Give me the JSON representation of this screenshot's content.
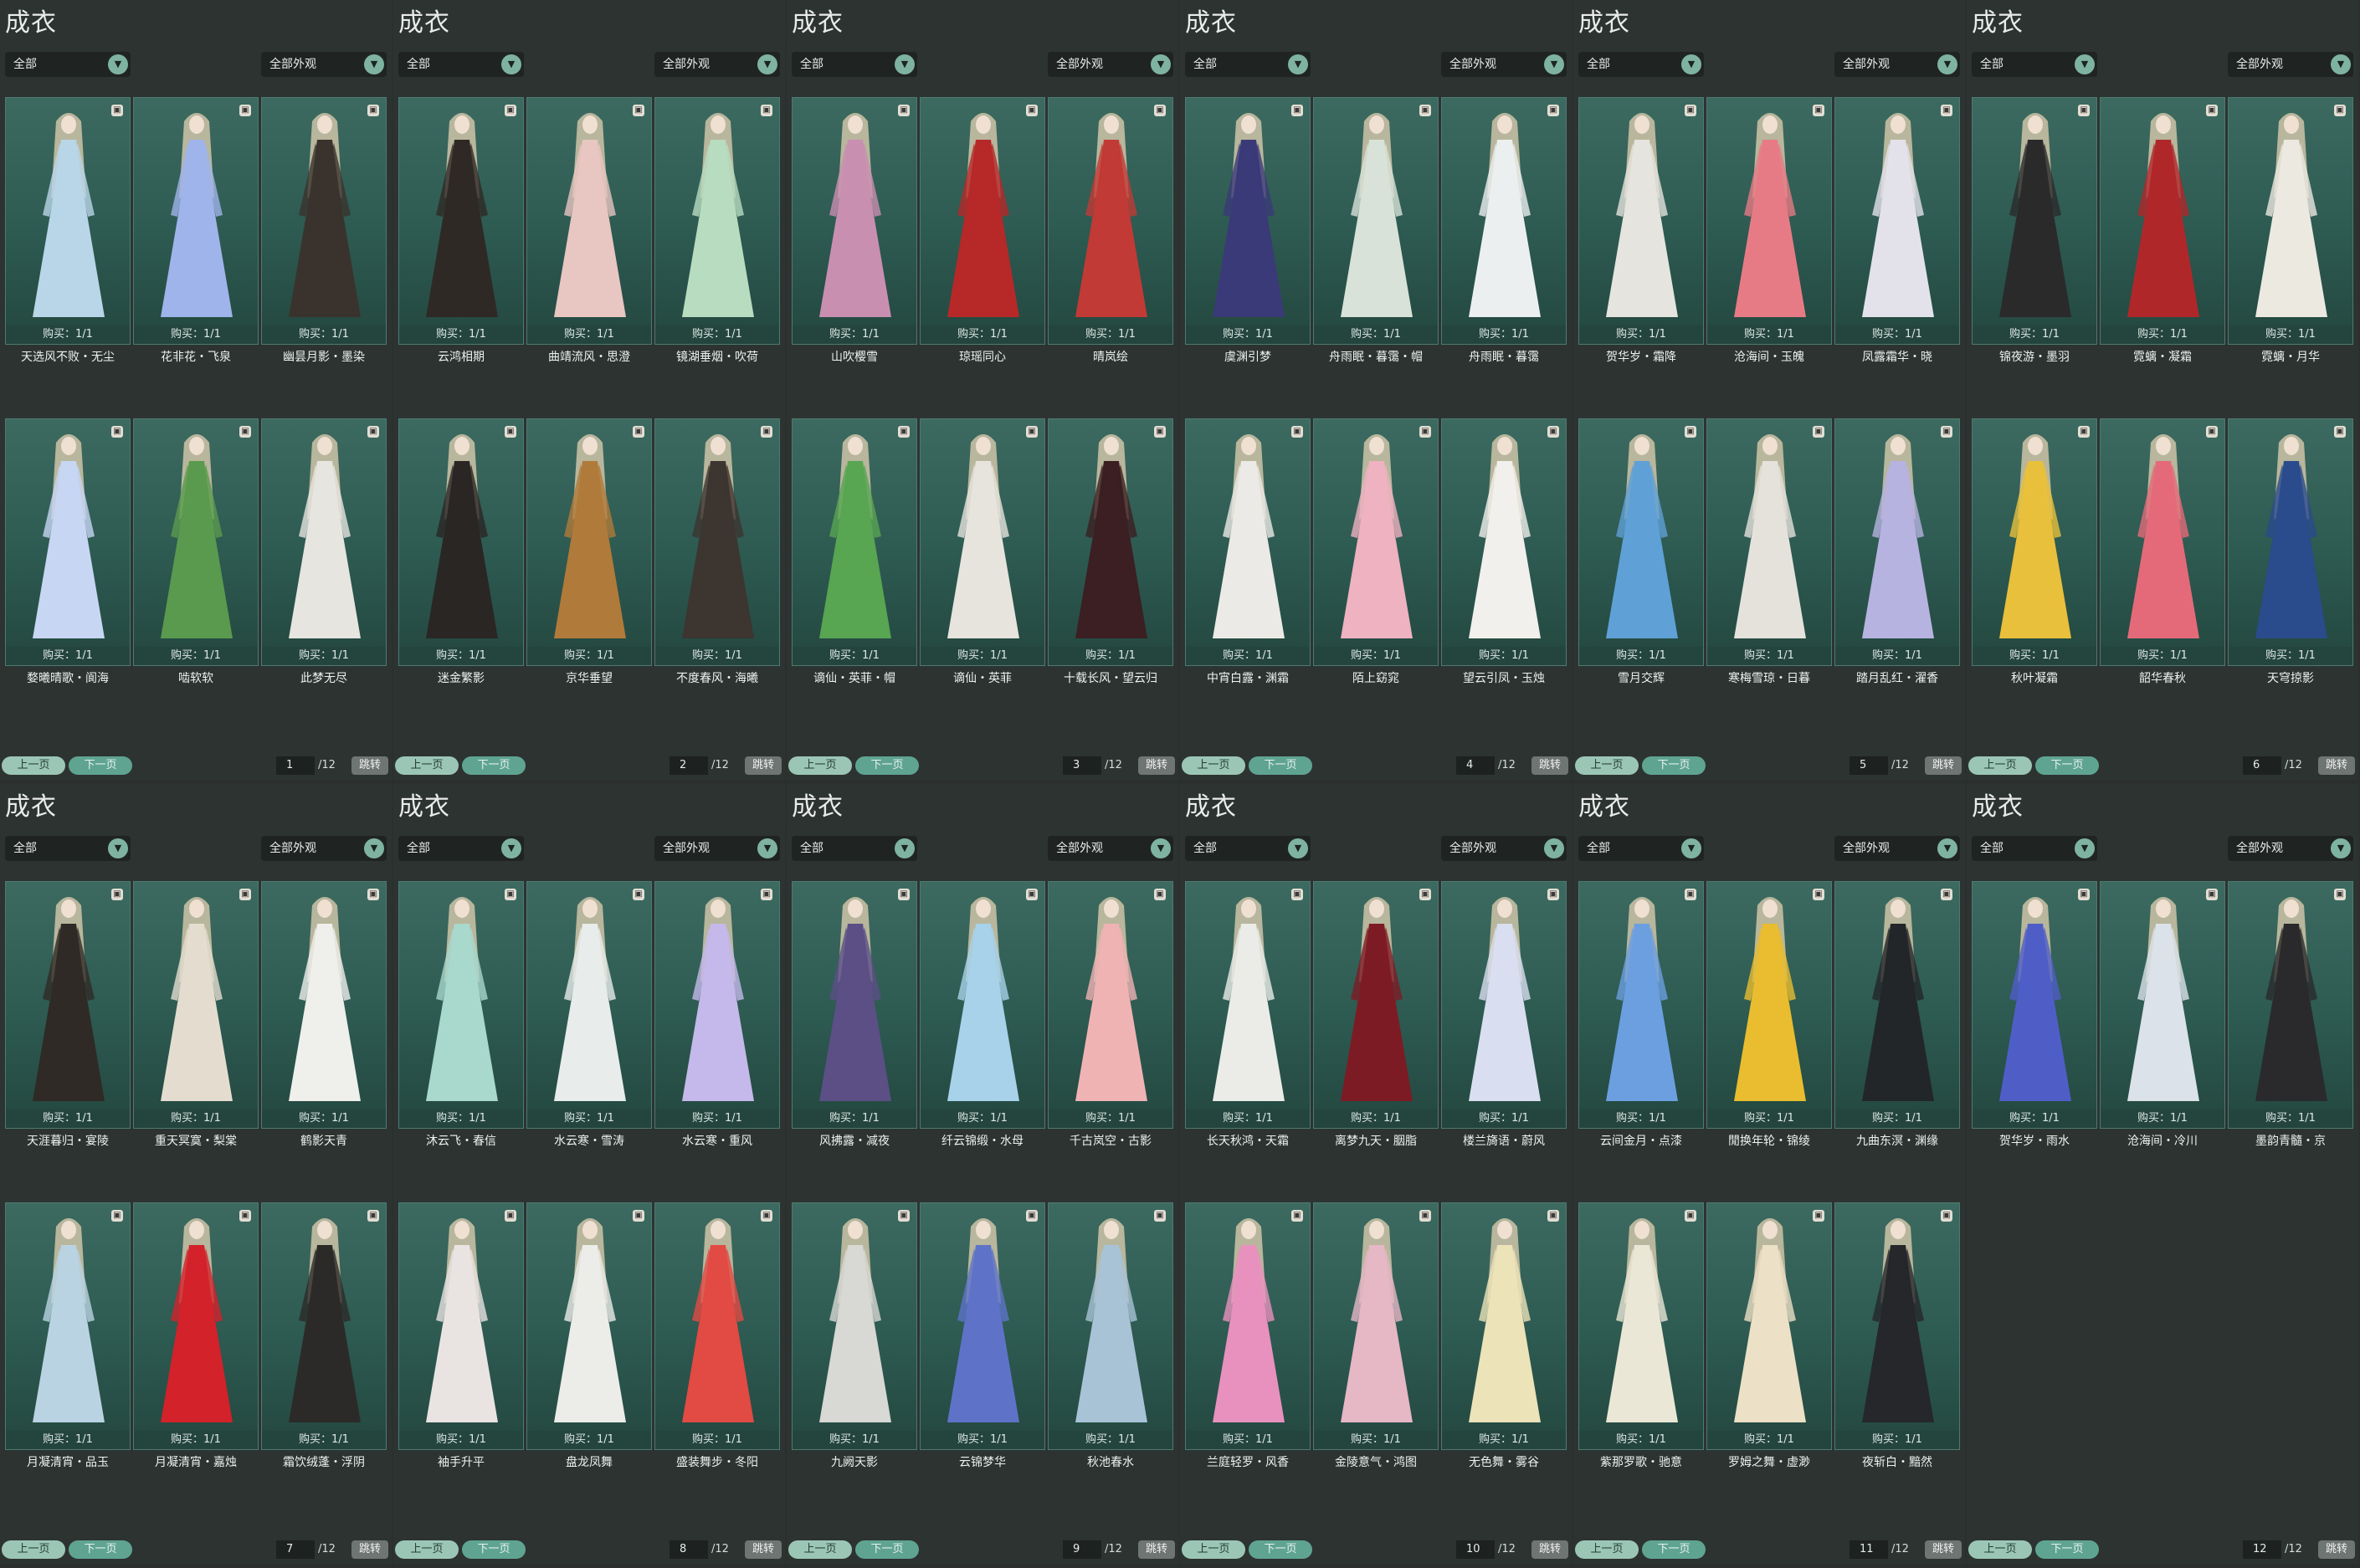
{
  "panels": [
    {
      "title": "成衣",
      "filter_left": "全部",
      "filter_right": "全部外观",
      "page": "1",
      "total": "/12",
      "prev": "上一页",
      "next": "下一页",
      "jump": "跳转",
      "items": [
        {
          "name": "天选风不败・无尘",
          "buy": "购买：1/1",
          "c": "#b9d6e8"
        },
        {
          "name": "花非花・飞泉",
          "buy": "购买：1/1",
          "c": "#9fb4ea"
        },
        {
          "name": "幽昙月影・墨染",
          "buy": "购买：1/1",
          "c": "#3a332d"
        },
        {
          "name": "婺曦晴歌・阆海",
          "buy": "购买：1/1",
          "c": "#c7d6f2"
        },
        {
          "name": "啮软软",
          "buy": "购买：1/1",
          "c": "#5a9a4e"
        },
        {
          "name": "此梦无尽",
          "buy": "购买：1/1",
          "c": "#e7e5e0"
        }
      ]
    },
    {
      "title": "成衣",
      "filter_left": "全部",
      "filter_right": "全部外观",
      "page": "2",
      "total": "/12",
      "prev": "上一页",
      "next": "下一页",
      "jump": "跳转",
      "items": [
        {
          "name": "云鸿相期",
          "buy": "购买：1/1",
          "c": "#2f2926"
        },
        {
          "name": "曲靖流风・思澄",
          "buy": "购买：1/1",
          "c": "#e8c6c1"
        },
        {
          "name": "镜湖垂烟・吹荷",
          "buy": "购买：1/1",
          "c": "#b8dcbf"
        },
        {
          "name": "迷金繁影",
          "buy": "购买：1/1",
          "c": "#2a2624"
        },
        {
          "name": "京华垂望",
          "buy": "购买：1/1",
          "c": "#b07a3a"
        },
        {
          "name": "不度春风・海曦",
          "buy": "购买：1/1",
          "c": "#3d3530"
        }
      ]
    },
    {
      "title": "成衣",
      "filter_left": "全部",
      "filter_right": "全部外观",
      "page": "3",
      "total": "/12",
      "prev": "上一页",
      "next": "下一页",
      "jump": "跳转",
      "items": [
        {
          "name": "山吹樱雪",
          "buy": "购买：1/1",
          "c": "#c98fb0"
        },
        {
          "name": "琼瑶同心",
          "buy": "购买：1/1",
          "c": "#b72828"
        },
        {
          "name": "晴岚绘",
          "buy": "购买：1/1",
          "c": "#c23a35"
        },
        {
          "name": "谪仙・英菲・帽",
          "buy": "购买：1/1",
          "c": "#58a552"
        },
        {
          "name": "谪仙・英菲",
          "buy": "购买：1/1",
          "c": "#e7e4dd"
        },
        {
          "name": "十载长风・望云归",
          "buy": "购买：1/1",
          "c": "#3b1f22"
        }
      ]
    },
    {
      "title": "成衣",
      "filter_left": "全部",
      "filter_right": "全部外观",
      "page": "4",
      "total": "/12",
      "prev": "上一页",
      "next": "下一页",
      "jump": "跳转",
      "items": [
        {
          "name": "虞渊引梦",
          "buy": "购买：1/1",
          "c": "#3b3a78"
        },
        {
          "name": "舟雨眠・暮霭・帽",
          "buy": "购买：1/1",
          "c": "#d8e2d8"
        },
        {
          "name": "舟雨眠・暮霭",
          "buy": "购买：1/1",
          "c": "#eceff0"
        },
        {
          "name": "中宵白露・渊霜",
          "buy": "购买：1/1",
          "c": "#eceae6"
        },
        {
          "name": "陌上窈窕",
          "buy": "购买：1/1",
          "c": "#efb2c0"
        },
        {
          "name": "望云引凤・玉烛",
          "buy": "购买：1/1",
          "c": "#f2f0ec"
        }
      ]
    },
    {
      "title": "成衣",
      "filter_left": "全部",
      "filter_right": "全部外观",
      "page": "5",
      "total": "/12",
      "prev": "上一页",
      "next": "下一页",
      "jump": "跳转",
      "items": [
        {
          "name": "贺华岁・霜降",
          "buy": "购买：1/1",
          "c": "#e6e4df"
        },
        {
          "name": "沧海间・玉魄",
          "buy": "购买：1/1",
          "c": "#e77b85"
        },
        {
          "name": "凤露霜华・晓",
          "buy": "购买：1/1",
          "c": "#e3e2ea"
        },
        {
          "name": "雪月交辉",
          "buy": "购买：1/1",
          "c": "#5fa0d6"
        },
        {
          "name": "寒梅雪琼・日暮",
          "buy": "购买：1/1",
          "c": "#e5e2dc"
        },
        {
          "name": "踏月乱红・濯香",
          "buy": "购买：1/1",
          "c": "#b7b3e0"
        }
      ]
    },
    {
      "title": "成衣",
      "filter_left": "全部",
      "filter_right": "全部外观",
      "page": "6",
      "total": "/12",
      "prev": "上一页",
      "next": "下一页",
      "jump": "跳转",
      "items": [
        {
          "name": "锦夜游・墨羽",
          "buy": "购买：1/1",
          "c": "#2b2a2b"
        },
        {
          "name": "霓螭・凝霜",
          "buy": "购买：1/1",
          "c": "#b0272a"
        },
        {
          "name": "霓螭・月华",
          "buy": "购买：1/1",
          "c": "#ece9e1"
        },
        {
          "name": "秋叶凝霜",
          "buy": "购买：1/1",
          "c": "#e9c03b"
        },
        {
          "name": "韶华春秋",
          "buy": "购买：1/1",
          "c": "#e56a79"
        },
        {
          "name": "天穹掠影",
          "buy": "购买：1/1",
          "c": "#2a4b8c"
        }
      ]
    },
    {
      "title": "成衣",
      "filter_left": "全部",
      "filter_right": "全部外观",
      "page": "7",
      "total": "/12",
      "prev": "上一页",
      "next": "下一页",
      "jump": "跳转",
      "items": [
        {
          "name": "天涯暮归・宴陵",
          "buy": "购买：1/1",
          "c": "#2f2a26"
        },
        {
          "name": "重天冥寞・梨棠",
          "buy": "购买：1/1",
          "c": "#e4ddcf"
        },
        {
          "name": "鹤影天青",
          "buy": "购买：1/1",
          "c": "#efefec"
        },
        {
          "name": "月凝清宵・品玉",
          "buy": "购买：1/1",
          "c": "#b9d3e2"
        },
        {
          "name": "月凝清宵・嘉烛",
          "buy": "购买：1/1",
          "c": "#d3222a"
        },
        {
          "name": "霜饮绒蓬・浮阴",
          "buy": "购买：1/1",
          "c": "#2c2a28"
        }
      ]
    },
    {
      "title": "成衣",
      "filter_left": "全部",
      "filter_right": "全部外观",
      "page": "8",
      "total": "/12",
      "prev": "上一页",
      "next": "下一页",
      "jump": "跳转",
      "items": [
        {
          "name": "沐云飞・春信",
          "buy": "购买：1/1",
          "c": "#a9d8cc"
        },
        {
          "name": "水云寒・雪涛",
          "buy": "购买：1/1",
          "c": "#e8ecea"
        },
        {
          "name": "水云寒・重风",
          "buy": "购买：1/1",
          "c": "#c4b9ea"
        },
        {
          "name": "袖手升平",
          "buy": "购买：1/1",
          "c": "#e9e4e2"
        },
        {
          "name": "盘龙凤舞",
          "buy": "购买：1/1",
          "c": "#ecece8"
        },
        {
          "name": "盛装舞步・冬阳",
          "buy": "购买：1/1",
          "c": "#e24a44"
        }
      ]
    },
    {
      "title": "成衣",
      "filter_left": "全部",
      "filter_right": "全部外观",
      "page": "9",
      "total": "/12",
      "prev": "上一页",
      "next": "下一页",
      "jump": "跳转",
      "items": [
        {
          "name": "风拂露・减夜",
          "buy": "购买：1/1",
          "c": "#5b4f86"
        },
        {
          "name": "纤云锦缎・水母",
          "buy": "购买：1/1",
          "c": "#a8d2ea"
        },
        {
          "name": "千古岚空・古影",
          "buy": "购买：1/1",
          "c": "#f0b3b4"
        },
        {
          "name": "九阙天影",
          "buy": "购买：1/1",
          "c": "#d8d8d4"
        },
        {
          "name": "云锦梦华",
          "buy": "购买：1/1",
          "c": "#5e73c8"
        },
        {
          "name": "秋池春水",
          "buy": "购买：1/1",
          "c": "#a9c3d6"
        }
      ]
    },
    {
      "title": "成衣",
      "filter_left": "全部",
      "filter_right": "全部外观",
      "page": "10",
      "total": "/12",
      "prev": "上一页",
      "next": "下一页",
      "jump": "跳转",
      "items": [
        {
          "name": "长天秋鸿・天霜",
          "buy": "购买：1/1",
          "c": "#ebece8"
        },
        {
          "name": "离梦九天・胭脂",
          "buy": "购买：1/1",
          "c": "#7d1b24"
        },
        {
          "name": "楼兰旖语・蔚风",
          "buy": "购买：1/1",
          "c": "#d9dff0"
        },
        {
          "name": "兰庭轻罗・风香",
          "buy": "购买：1/1",
          "c": "#e891be"
        },
        {
          "name": "金陵意气・鸿图",
          "buy": "购买：1/1",
          "c": "#e6b7c5"
        },
        {
          "name": "无色舞・雾谷",
          "buy": "购买：1/1",
          "c": "#ece3b9"
        }
      ]
    },
    {
      "title": "成衣",
      "filter_left": "全部",
      "filter_right": "全部外观",
      "page": "11",
      "total": "/12",
      "prev": "上一页",
      "next": "下一页",
      "jump": "跳转",
      "items": [
        {
          "name": "云间金月・点漆",
          "buy": "购买：1/1",
          "c": "#6c9fe0"
        },
        {
          "name": "閒换年轮・锦绫",
          "buy": "购买：1/1",
          "c": "#e9bd2f"
        },
        {
          "name": "九曲东溟・渊缘",
          "buy": "购买：1/1",
          "c": "#232628"
        },
        {
          "name": "紫那罗歌・驰意",
          "buy": "购买：1/1",
          "c": "#ebe7d6"
        },
        {
          "name": "罗姆之舞・虚渺",
          "buy": "购买：1/1",
          "c": "#ece0c6"
        },
        {
          "name": "夜斩白・黯然",
          "buy": "购买：1/1",
          "c": "#25272b"
        }
      ]
    },
    {
      "title": "成衣",
      "filter_left": "全部",
      "filter_right": "全部外观",
      "page": "12",
      "total": "/12",
      "prev": "上一页",
      "next": "下一页",
      "jump": "跳转",
      "items": [
        {
          "name": "贺华岁・雨水",
          "buy": "购买：1/1",
          "c": "#4f5ec7"
        },
        {
          "name": "沧海间・冷川",
          "buy": "购买：1/1",
          "c": "#dbe2e9"
        },
        {
          "name": "墨韵青髓・京",
          "buy": "购买：1/1",
          "c": "#2a2a2c"
        }
      ]
    }
  ]
}
